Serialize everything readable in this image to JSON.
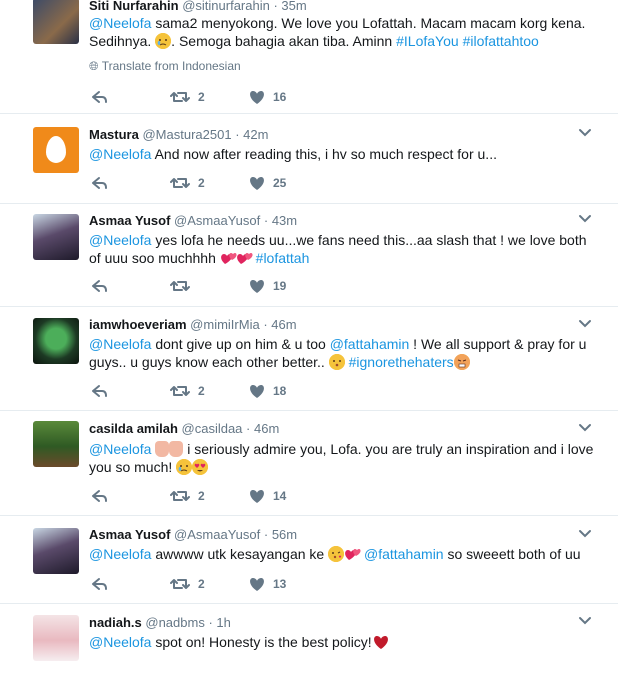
{
  "colors": {
    "link": "#1b95e0",
    "muted": "#657786",
    "divider": "#e6ecf0",
    "heart_red": "#e0245e"
  },
  "translate_label": "Translate from Indonesian",
  "tweets": [
    {
      "name": "Siti Nurfarahin",
      "handle": "@sitinurfarahin",
      "time": "35m",
      "parts": [
        {
          "t": "mention",
          "v": "@Neelofa"
        },
        {
          "t": "text",
          "v": " sama2 menyokong. We love you Lofattah. Macam macam korg kena. Sedihnya. "
        },
        {
          "t": "emoji",
          "v": "crying-face"
        },
        {
          "t": "text",
          "v": ". Semoga bahagia akan tiba. Aminn "
        },
        {
          "t": "hashtag",
          "v": "#ILofaYou"
        },
        {
          "t": "text",
          "v": " "
        },
        {
          "t": "hashtag",
          "v": "#ilofattahtoo"
        }
      ],
      "retweets": "2",
      "likes": "16"
    },
    {
      "name": "Mastura",
      "handle": "@Mastura2501",
      "time": "42m",
      "parts": [
        {
          "t": "mention",
          "v": "@Neelofa"
        },
        {
          "t": "text",
          "v": " And now after reading this, i hv so much respect for u..."
        }
      ],
      "retweets": "2",
      "likes": "25"
    },
    {
      "name": "Asmaa Yusof",
      "handle": "@AsmaaYusof",
      "time": "43m",
      "parts": [
        {
          "t": "mention",
          "v": "@Neelofa"
        },
        {
          "t": "text",
          "v": " yes lofa he needs uu...we fans need this...aa slash that ! we love both of uuu soo muchhhh "
        },
        {
          "t": "emoji",
          "v": "two-hearts"
        },
        {
          "t": "emoji",
          "v": "two-hearts"
        },
        {
          "t": "text",
          "v": " "
        },
        {
          "t": "hashtag",
          "v": "#lofattah"
        }
      ],
      "retweets": "",
      "likes": "19"
    },
    {
      "name": "iamwhoeveriam",
      "handle": "@mimiIrMia",
      "time": "46m",
      "parts": [
        {
          "t": "mention",
          "v": "@Neelofa"
        },
        {
          "t": "text",
          "v": " dont give up on him & u too "
        },
        {
          "t": "mention",
          "v": "@fattahamin"
        },
        {
          "t": "text",
          "v": " ! We all support & pray for u guys.. u guys know each other better.. "
        },
        {
          "t": "emoji",
          "v": "kissing-face"
        },
        {
          "t": "text",
          "v": "   "
        },
        {
          "t": "hashtag",
          "v": "#ignorethehaters"
        },
        {
          "t": "emoji",
          "v": "angry-face"
        }
      ],
      "retweets": "2",
      "likes": "18"
    },
    {
      "name": "casilda amilah",
      "handle": "@casildaa",
      "time": "46m",
      "parts": [
        {
          "t": "mention",
          "v": "@Neelofa"
        },
        {
          "t": "text",
          "v": " "
        },
        {
          "t": "emoji",
          "v": "thumbs-up"
        },
        {
          "t": "emoji",
          "v": "thumbs-up"
        },
        {
          "t": "text",
          "v": " i seriously admire you, Lofa. you are truly an inspiration and i love you so much! "
        },
        {
          "t": "emoji",
          "v": "crying-face"
        },
        {
          "t": "emoji",
          "v": "heart-eyes-face"
        }
      ],
      "retweets": "2",
      "likes": "14"
    },
    {
      "name": "Asmaa Yusof",
      "handle": "@AsmaaYusof",
      "time": "56m",
      "parts": [
        {
          "t": "mention",
          "v": "@Neelofa"
        },
        {
          "t": "text",
          "v": " awwww utk kesayangan ke "
        },
        {
          "t": "emoji",
          "v": "kissing-heart-face"
        },
        {
          "t": "emoji",
          "v": "two-hearts"
        },
        {
          "t": "text",
          "v": " "
        },
        {
          "t": "mention",
          "v": "@fattahamin"
        },
        {
          "t": "text",
          "v": " so sweeett both of uu"
        }
      ],
      "retweets": "2",
      "likes": "13"
    },
    {
      "name": "nadiah.s",
      "handle": "@nadbms",
      "time": "1h",
      "parts": [
        {
          "t": "mention",
          "v": "@Neelofa"
        },
        {
          "t": "text",
          "v": " spot on! Honesty is the best policy!"
        },
        {
          "t": "emoji",
          "v": "red-heart"
        }
      ],
      "retweets": "",
      "likes": ""
    }
  ]
}
